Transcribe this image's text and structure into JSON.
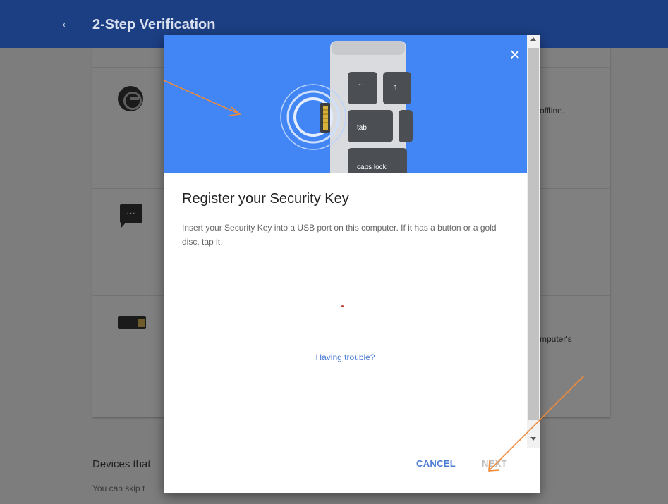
{
  "header": {
    "back_icon": "arrow-left-icon",
    "title": "2-Step Verification"
  },
  "background_card": {
    "option1_icon": "google-authenticator-icon",
    "option1_partial_text": "offline.",
    "option2_icon": "text-message-icon",
    "option3_icon": "security-key-icon",
    "option3_partial_text": "mputer's"
  },
  "background_section": {
    "heading": "Devices that",
    "subtext": "You can skip t"
  },
  "dialog": {
    "close_icon": "close-icon",
    "illustration_keys": [
      "~",
      "1",
      "tab",
      "caps lock"
    ],
    "title": "Register your Security Key",
    "body": "Insert your Security Key into a USB port on this computer. If it has a button or a gold disc, tap it.",
    "trouble_link": "Having trouble?",
    "cancel_label": "CANCEL",
    "next_label": "NEXT"
  },
  "colors": {
    "header_bar": "#1c3f84",
    "hero_background": "#4285f4",
    "link": "#4a7bd5",
    "annotation_arrow": "#f08a3c"
  }
}
